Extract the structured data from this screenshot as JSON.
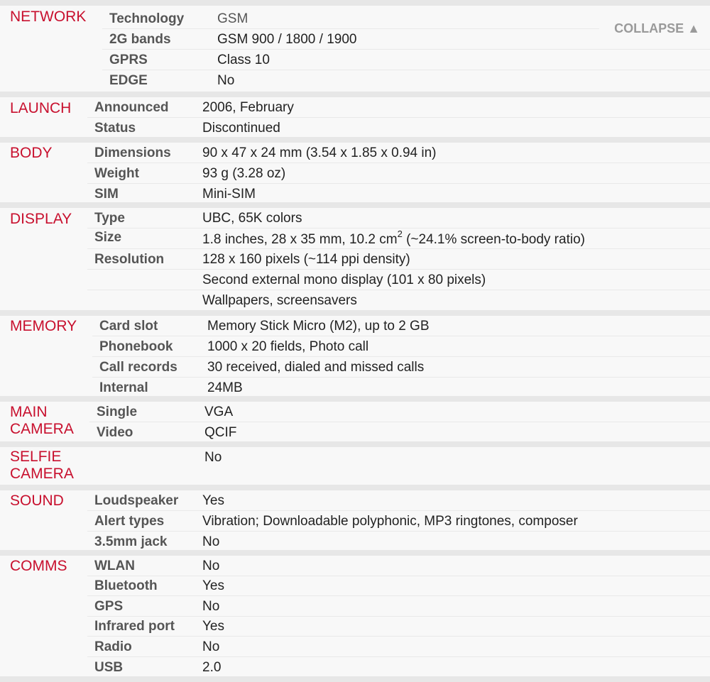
{
  "collapse": {
    "label": "COLLAPSE",
    "icon": "triangle-up-icon"
  },
  "network": {
    "title": "NETWORK",
    "rows": [
      {
        "label": "Technology",
        "value": "GSM"
      },
      {
        "label": "2G bands",
        "value": "GSM 900 / 1800 / 1900"
      },
      {
        "label": "GPRS",
        "value": "Class 10"
      },
      {
        "label": "EDGE",
        "value": "No"
      }
    ]
  },
  "launch": {
    "title": "LAUNCH",
    "rows": [
      {
        "label": "Announced",
        "value": "2006, February"
      },
      {
        "label": "Status",
        "value": "Discontinued"
      }
    ]
  },
  "body": {
    "title": "BODY",
    "rows": [
      {
        "label": "Dimensions",
        "value": "90 x 47 x 24 mm (3.54 x 1.85 x 0.94 in)"
      },
      {
        "label": "Weight",
        "value": "93 g (3.28 oz)"
      },
      {
        "label": "SIM",
        "value": "Mini-SIM"
      }
    ]
  },
  "display": {
    "title": "DISPLAY",
    "rows": [
      {
        "label": "Type",
        "value": "UBC, 65K colors"
      },
      {
        "label": "Size",
        "value_a": "1.8 inches, 28 x 35 mm, 10.2 cm",
        "value_sup": "2",
        "value_b": " (~24.1% screen-to-body ratio)"
      },
      {
        "label": "Resolution",
        "value": "128 x 160 pixels (~114 ppi density)"
      },
      {
        "label": "",
        "value": "Second external mono display (101 x 80 pixels)"
      },
      {
        "label": "",
        "value": "Wallpapers, screensavers"
      }
    ]
  },
  "memory": {
    "title": "MEMORY",
    "rows": [
      {
        "label": "Card slot",
        "value": "Memory Stick Micro (M2), up to 2 GB"
      },
      {
        "label": "Phonebook",
        "value": "1000 x 20 fields, Photo call"
      },
      {
        "label": "Call records",
        "value": "30 received, dialed and missed calls"
      },
      {
        "label": "Internal",
        "value": "24MB"
      }
    ]
  },
  "main_camera": {
    "title_line1": "MAIN",
    "title_line2": "CAMERA",
    "rows": [
      {
        "label": "Single",
        "value": "VGA"
      },
      {
        "label": "Video",
        "value": "QCIF"
      }
    ]
  },
  "selfie_camera": {
    "title_line1": "SELFIE",
    "title_line2": "CAMERA",
    "rows": [
      {
        "label": "",
        "value": "No"
      }
    ]
  },
  "sound": {
    "title": "SOUND",
    "rows": [
      {
        "label": "Loudspeaker",
        "value": "Yes"
      },
      {
        "label": "Alert types",
        "value": "Vibration; Downloadable polyphonic, MP3 ringtones, composer"
      },
      {
        "label": "3.5mm jack",
        "value": "No"
      }
    ]
  },
  "comms": {
    "title": "COMMS",
    "rows": [
      {
        "label": "WLAN",
        "value": "No"
      },
      {
        "label": "Bluetooth",
        "value": "Yes"
      },
      {
        "label": "GPS",
        "value": "No"
      },
      {
        "label": "Infrared port",
        "value": "Yes"
      },
      {
        "label": "Radio",
        "value": "No"
      },
      {
        "label": "USB",
        "value": "2.0"
      }
    ]
  }
}
